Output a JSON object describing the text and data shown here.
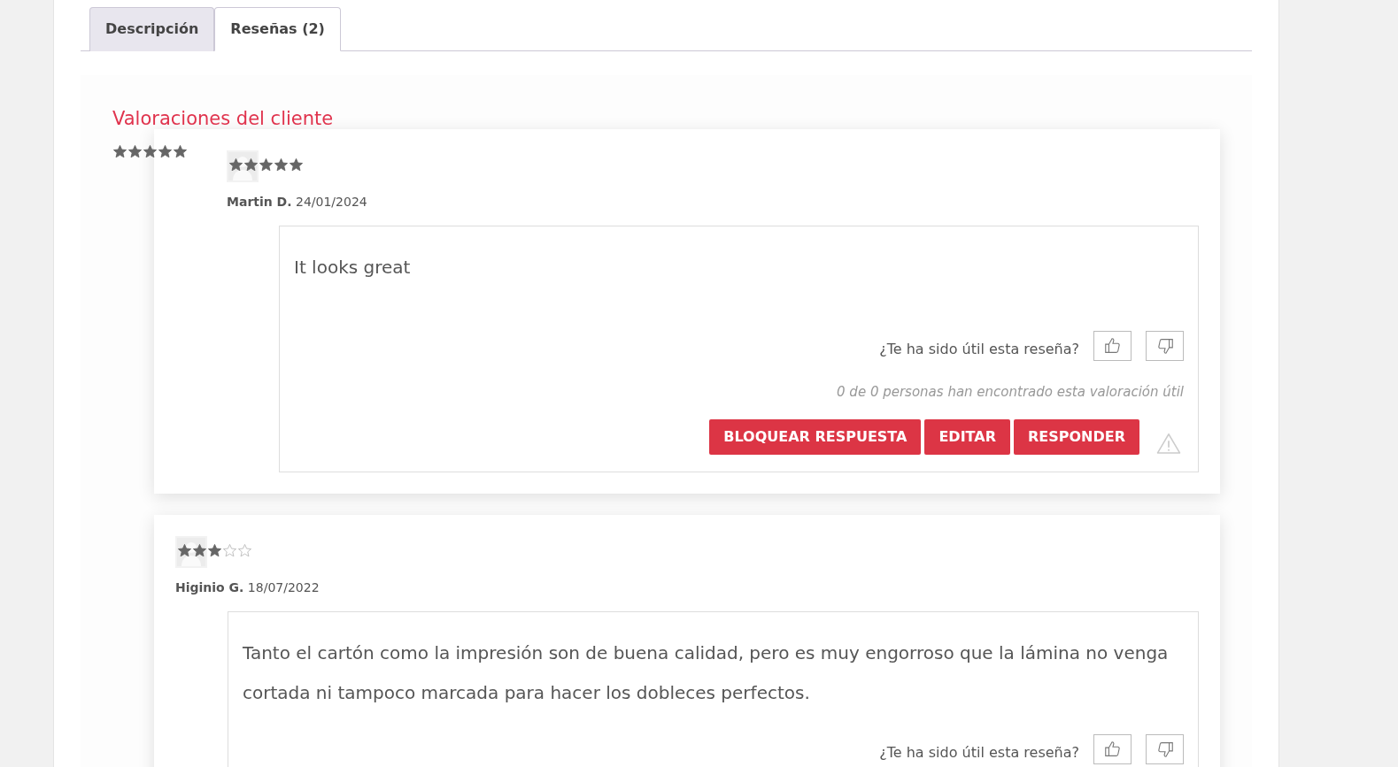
{
  "tabs": [
    {
      "label": "Descripción",
      "selected": false
    },
    {
      "label": "Reseñas (2)",
      "selected": true
    }
  ],
  "reviews_title": "Valoraciones del cliente",
  "overall": {
    "stars": 5
  },
  "reviews": [
    {
      "stars": 5,
      "author": "Martin D.",
      "date": "24/01/2024",
      "text": "It looks great",
      "helpful_question": "¿Te ha sido útil esta reseña?",
      "helpful_count": "0 de 0 personas han encontrado esta valoración útil",
      "buttons": [
        "BLOQUEAR RESPUESTA",
        "EDITAR",
        "RESPONDER"
      ]
    },
    {
      "stars": 3,
      "author": "Higinio G.",
      "date": "18/07/2022",
      "text": "Tanto el cartón como la impresión son de buena calidad, pero es muy engorroso que la lámina no venga cortada ni tampoco marcada para hacer los dobleces perfectos.",
      "helpful_question": "¿Te ha sido útil esta reseña?"
    }
  ]
}
